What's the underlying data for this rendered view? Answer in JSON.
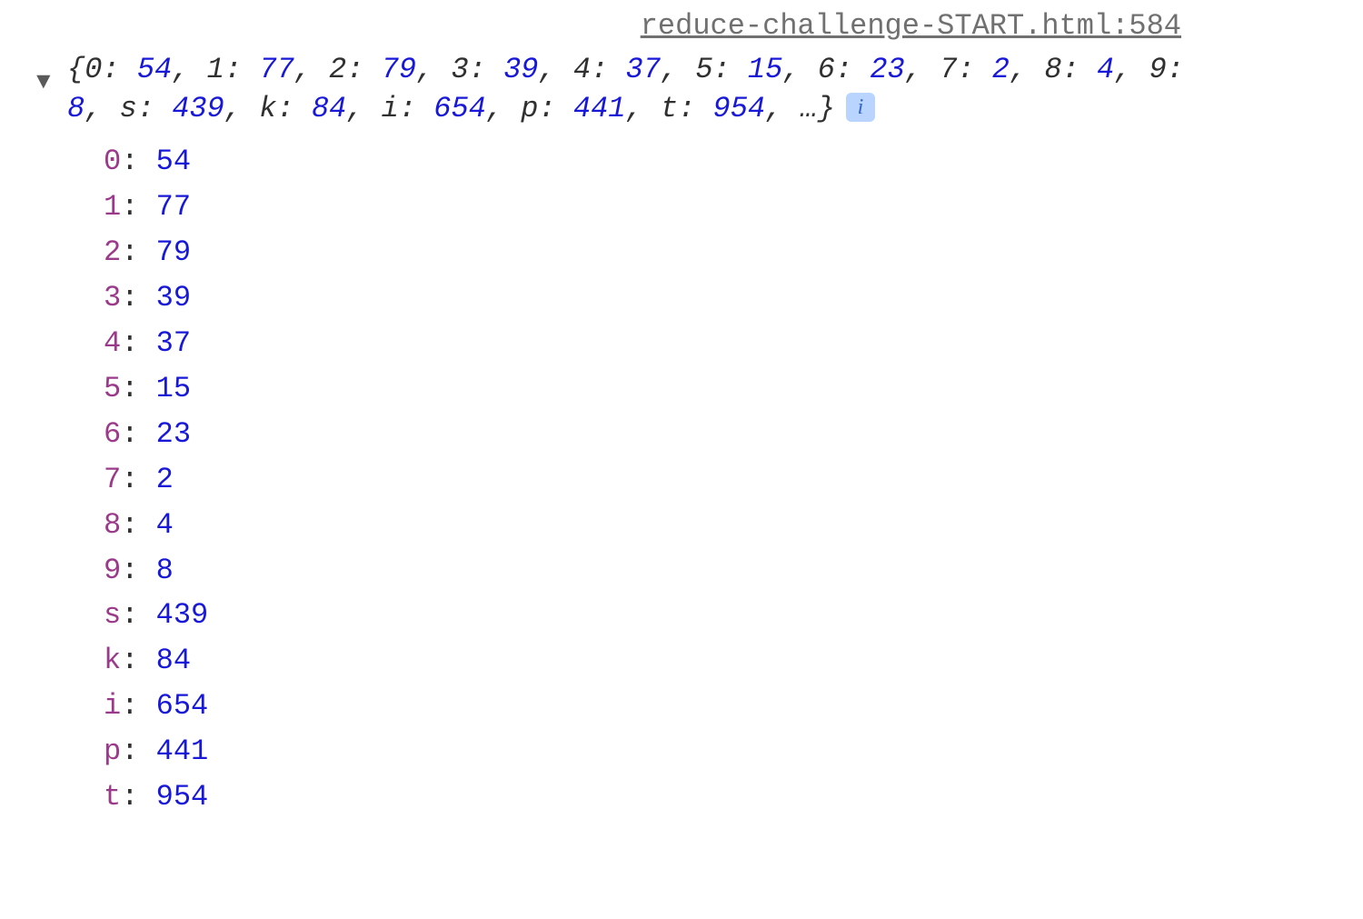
{
  "sourceLink": "reduce-challenge-START.html:584",
  "infoBadge": "i",
  "summaryPairs": [
    {
      "k": "0",
      "v": "54"
    },
    {
      "k": "1",
      "v": "77"
    },
    {
      "k": "2",
      "v": "79"
    },
    {
      "k": "3",
      "v": "39"
    },
    {
      "k": "4",
      "v": "37"
    },
    {
      "k": "5",
      "v": "15"
    },
    {
      "k": "6",
      "v": "23"
    },
    {
      "k": "7",
      "v": "2"
    },
    {
      "k": "8",
      "v": "4"
    },
    {
      "k": "9",
      "v": "8"
    },
    {
      "k": "s",
      "v": "439"
    },
    {
      "k": "k",
      "v": "84"
    },
    {
      "k": "i",
      "v": "654"
    },
    {
      "k": "p",
      "v": "441"
    },
    {
      "k": "t",
      "v": "954"
    }
  ],
  "summaryEllipsis": "…",
  "entries": [
    {
      "k": "0",
      "v": "54"
    },
    {
      "k": "1",
      "v": "77"
    },
    {
      "k": "2",
      "v": "79"
    },
    {
      "k": "3",
      "v": "39"
    },
    {
      "k": "4",
      "v": "37"
    },
    {
      "k": "5",
      "v": "15"
    },
    {
      "k": "6",
      "v": "23"
    },
    {
      "k": "7",
      "v": "2"
    },
    {
      "k": "8",
      "v": "4"
    },
    {
      "k": "9",
      "v": "8"
    },
    {
      "k": "s",
      "v": "439"
    },
    {
      "k": "k",
      "v": "84"
    },
    {
      "k": "i",
      "v": "654"
    },
    {
      "k": "p",
      "v": "441"
    },
    {
      "k": "t",
      "v": "954"
    }
  ]
}
